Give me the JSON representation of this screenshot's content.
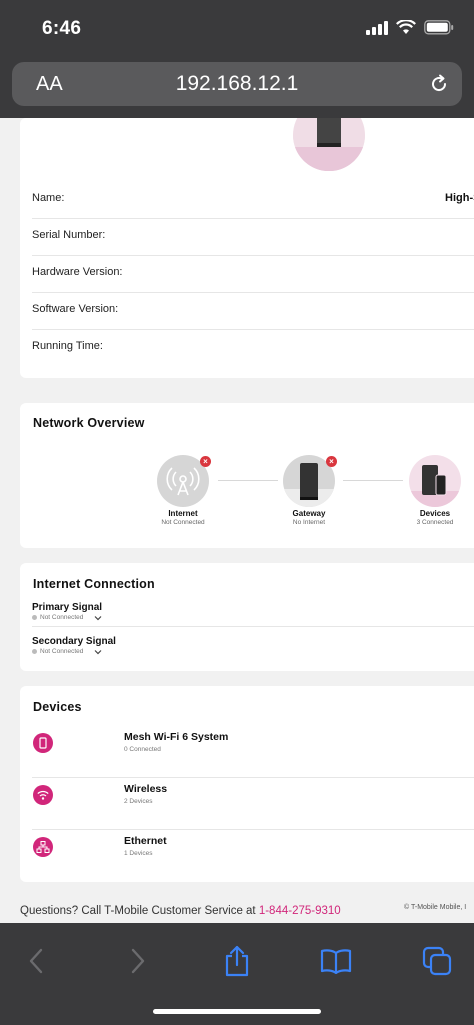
{
  "status_bar": {
    "time": "6:46"
  },
  "browser": {
    "aa_label": "AA",
    "url": "192.168.12.1"
  },
  "device_info": {
    "name_label": "Name:",
    "name_value": "High-Sp",
    "serial_label": "Serial Number:",
    "hardware_label": "Hardware Version:",
    "software_label": "Software Version:",
    "running_label": "Running Time:"
  },
  "network_overview": {
    "title": "Network Overview",
    "nodes": [
      {
        "label": "Internet",
        "status": "Not Connected"
      },
      {
        "label": "Gateway",
        "status": "No Internet"
      },
      {
        "label": "Devices",
        "status": "3 Connected"
      }
    ]
  },
  "internet_connection": {
    "title": "Internet Connection",
    "primary": {
      "label": "Primary Signal",
      "status": "Not Connected"
    },
    "secondary": {
      "label": "Secondary Signal",
      "status": "Not Connected"
    }
  },
  "devices": {
    "title": "Devices",
    "items": [
      {
        "label": "Mesh Wi-Fi 6 System",
        "count": "0 Connected",
        "icon": "mesh-icon"
      },
      {
        "label": "Wireless",
        "count": "2 Devices",
        "icon": "wifi-icon"
      },
      {
        "label": "Ethernet",
        "count": "1 Devices",
        "icon": "ethernet-icon"
      }
    ]
  },
  "footer": {
    "question_text": "Questions? Call T-Mobile Customer Service at ",
    "phone": "1-844-275-9310",
    "copyright": "© T-Mobile Mobile, I"
  },
  "colors": {
    "accent": "#d1267a",
    "error": "#d9363e",
    "chrome": "#3a3a3c",
    "toolbar_icon": "#3b82f6"
  }
}
